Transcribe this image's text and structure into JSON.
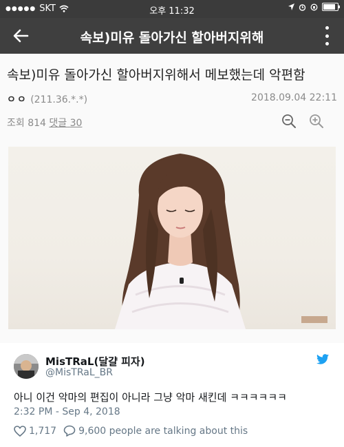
{
  "status_bar": {
    "carrier": "SKT",
    "time": "오후 11:32"
  },
  "app_bar": {
    "title": "속보)미유 돌아가신 할아버지위해"
  },
  "post": {
    "title": "속보)미유 돌아가신 할아버지위해서 메보했는데 악편함",
    "author": "ㅇㅇ",
    "ip": "(211.36.*.*)",
    "date": "2018.09.04 22:11",
    "views_label": "조회",
    "views": "814",
    "comments_label": "댓글",
    "comments": "30"
  },
  "tweet": {
    "name": "MisTRaL(달걀 피자)",
    "handle": "@MisTRaL_BR",
    "text": "아니 이건 악마의 편집이 아니라 그냥 악마 새킨데 ㅋㅋㅋㅋㅋㅋ",
    "time": "2:32 PM - Sep 4, 2018",
    "likes": "1,717",
    "talking": "9,600 people are talking about this"
  },
  "colors": {
    "app_bar": "#3f3f3f",
    "twitter_blue": "#1da1f2",
    "meta_gray": "#8a8a8a"
  },
  "icons": [
    "back-arrow-icon",
    "more-vertical-icon",
    "zoom-out-icon",
    "zoom-in-icon",
    "twitter-bird-icon",
    "heart-icon",
    "speech-bubble-icon"
  ]
}
